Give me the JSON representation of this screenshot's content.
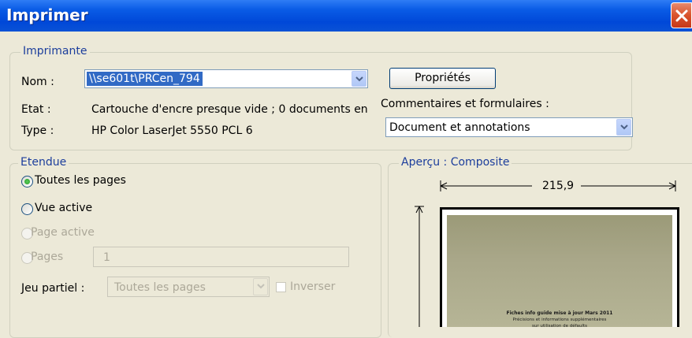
{
  "window": {
    "title": "Imprimer"
  },
  "printer": {
    "legend": "Imprimante",
    "name_label": "Nom :",
    "name_value": "\\\\se601t\\PRCen_794",
    "properties_button": "Propriétés",
    "state_label": "Etat :",
    "state_value": "Cartouche d'encre presque vide ; 0 documents en",
    "type_label": "Type :",
    "type_value": "HP Color LaserJet 5550 PCL 6",
    "comments_label": "Commentaires et formulaires :",
    "comments_value": "Document et annotations"
  },
  "range": {
    "legend": "Etendue",
    "options": [
      {
        "label": "Toutes les pages",
        "checked": true,
        "enabled": true
      },
      {
        "label": "Vue active",
        "checked": false,
        "enabled": true
      },
      {
        "label": "Page active",
        "checked": false,
        "enabled": false
      },
      {
        "label": "Pages",
        "checked": false,
        "enabled": false
      }
    ],
    "pages_value": "1",
    "subset_label": "Jeu partiel :",
    "subset_value": "Toutes les pages",
    "reverse_label": "Inverser"
  },
  "preview": {
    "legend": "Aperçu : Composite",
    "width_value": "215,9",
    "page_text_line1": "Fiches info guide mise à jour Mars 2011",
    "page_text_line2": "Précisions et informations supplémentaires",
    "page_text_line3": "sur utilisation de défaults"
  }
}
